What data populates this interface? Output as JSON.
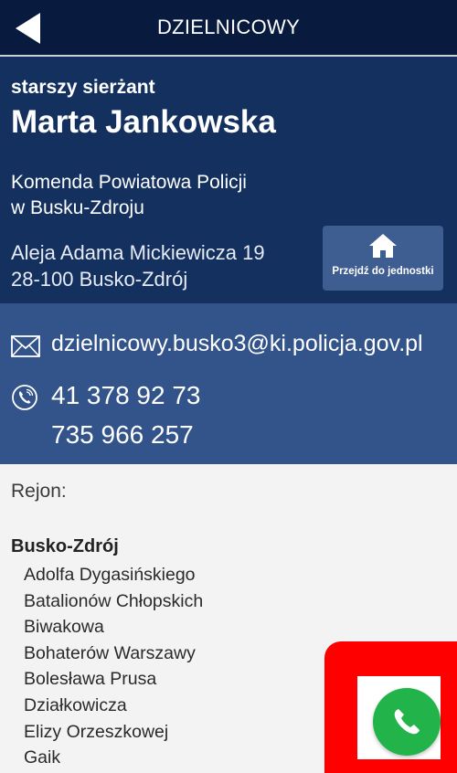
{
  "header": {
    "title": "DZIELNICOWY"
  },
  "officer": {
    "rank": "starszy sierżant",
    "name": "Marta Jankowska",
    "unit_line1": "Komenda Powiatowa Policji",
    "unit_line2": "w Busku-Zdroju",
    "address_line1": "Aleja Adama Mickiewicza 19",
    "address_line2": "28-100 Busko-Zdrój",
    "unit_button_label": "Przejdź do jednostki"
  },
  "contact": {
    "email": "dzielnicowy.busko3@ki.policja.gov.pl",
    "phone1": "41 378 92 73",
    "phone2": "735 966 257"
  },
  "region": {
    "label": "Rejon:",
    "city": "Busko-Zdrój",
    "streets": [
      "Adolfa Dygasińskiego",
      "Batalionów Chłopskich",
      "Biwakowa",
      "Bohaterów Warszawy",
      "Bolesława Prusa",
      "Działkowicza",
      "Elizy Orzeszkowej",
      "Gaik"
    ]
  },
  "icons": {
    "back": "back-arrow-icon",
    "home": "home-icon",
    "mail": "envelope-icon",
    "phone": "phone-icon",
    "call": "call-icon"
  },
  "colors": {
    "header_bg": "#081a3d",
    "officer_bg": "#13305f",
    "contact_bg": "#33548a",
    "unit_button_bg": "#3e5d91",
    "call_button": "#22b44a",
    "highlight": "#ff0000"
  }
}
